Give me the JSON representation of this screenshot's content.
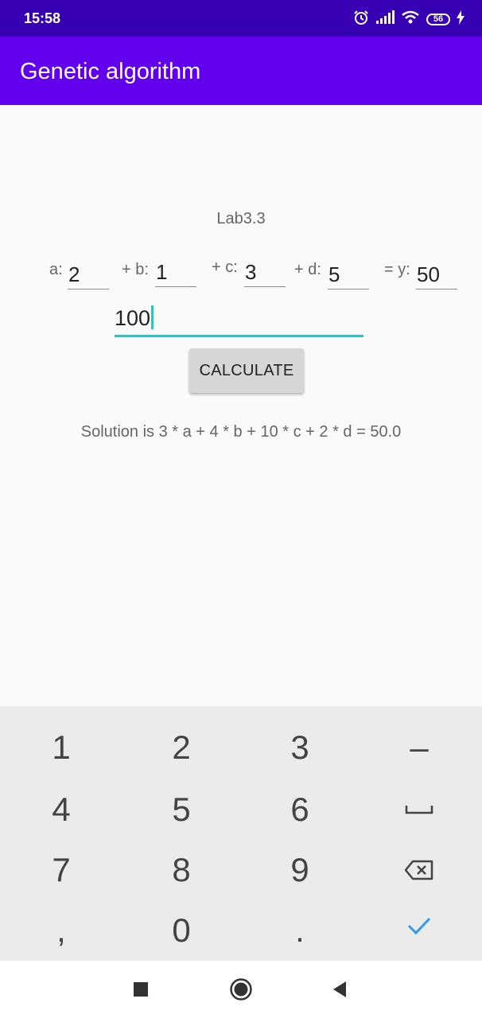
{
  "status_bar": {
    "time": "15:58",
    "battery": "56"
  },
  "app_bar": {
    "title": "Genetic algorithm"
  },
  "main": {
    "lab_label": "Lab3.3",
    "equation": {
      "a_label": "a:",
      "a_value": "2",
      "b_label": "+ b:",
      "b_value": "1",
      "c_label": "+ c:",
      "c_value": "3",
      "d_label": "+ d:",
      "d_value": "5",
      "y_label": "= y:",
      "y_value": "50"
    },
    "iterations_input": "100",
    "calculate_label": "CALCULATE",
    "solution_text": "Solution is 3 * a + 4 * b + 10 * c + 2 * d = 50.0"
  },
  "keyboard": {
    "row1": [
      "1",
      "2",
      "3",
      "–"
    ],
    "row2": [
      "4",
      "5",
      "6"
    ],
    "row3": [
      "7",
      "8",
      "9"
    ],
    "row4": [
      ",",
      "0",
      "."
    ]
  },
  "colors": {
    "status_bar": "#3700b3",
    "app_bar": "#6200ee",
    "accent": "#26c6c6",
    "keyboard_bg": "#ebebeb"
  }
}
